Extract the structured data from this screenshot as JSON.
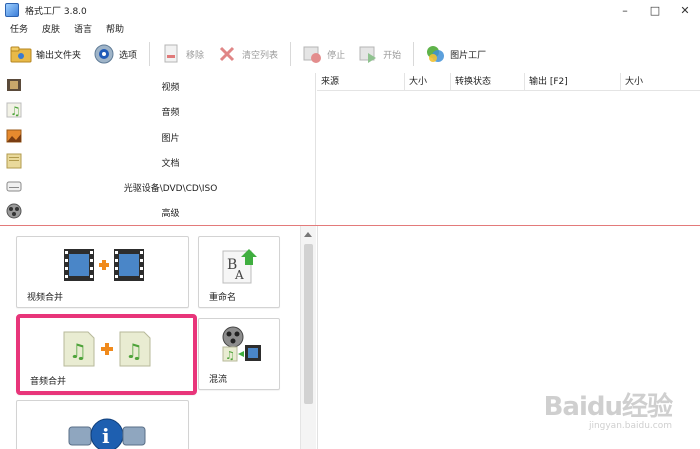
{
  "window": {
    "title": "格式工厂 3.8.0",
    "minimize": "–",
    "maximize": "□",
    "close": "✕"
  },
  "menu": [
    "任务",
    "皮肤",
    "语言",
    "帮助"
  ],
  "toolbar": {
    "output_folder": "输出文件夹",
    "options": "选项",
    "remove": "移除",
    "clear_list": "清空列表",
    "stop": "停止",
    "start": "开始",
    "picture_factory": "图片工厂"
  },
  "categories": [
    "视频",
    "音频",
    "图片",
    "文档",
    "光驱设备\\DVD\\CD\\ISO",
    "高级"
  ],
  "table_headers": [
    "来源",
    "大小",
    "转换状态",
    "输出 [F2]",
    "大小"
  ],
  "tools": {
    "video_merge": "视频合并",
    "rename": "重命名",
    "audio_merge": "音频合并",
    "mix": "混流"
  },
  "watermark": {
    "logo": "Baidu经验",
    "url": "jingyan.baidu.com"
  },
  "colors": {
    "selected_border": "#e8357a",
    "divider": "#e37a7a"
  }
}
